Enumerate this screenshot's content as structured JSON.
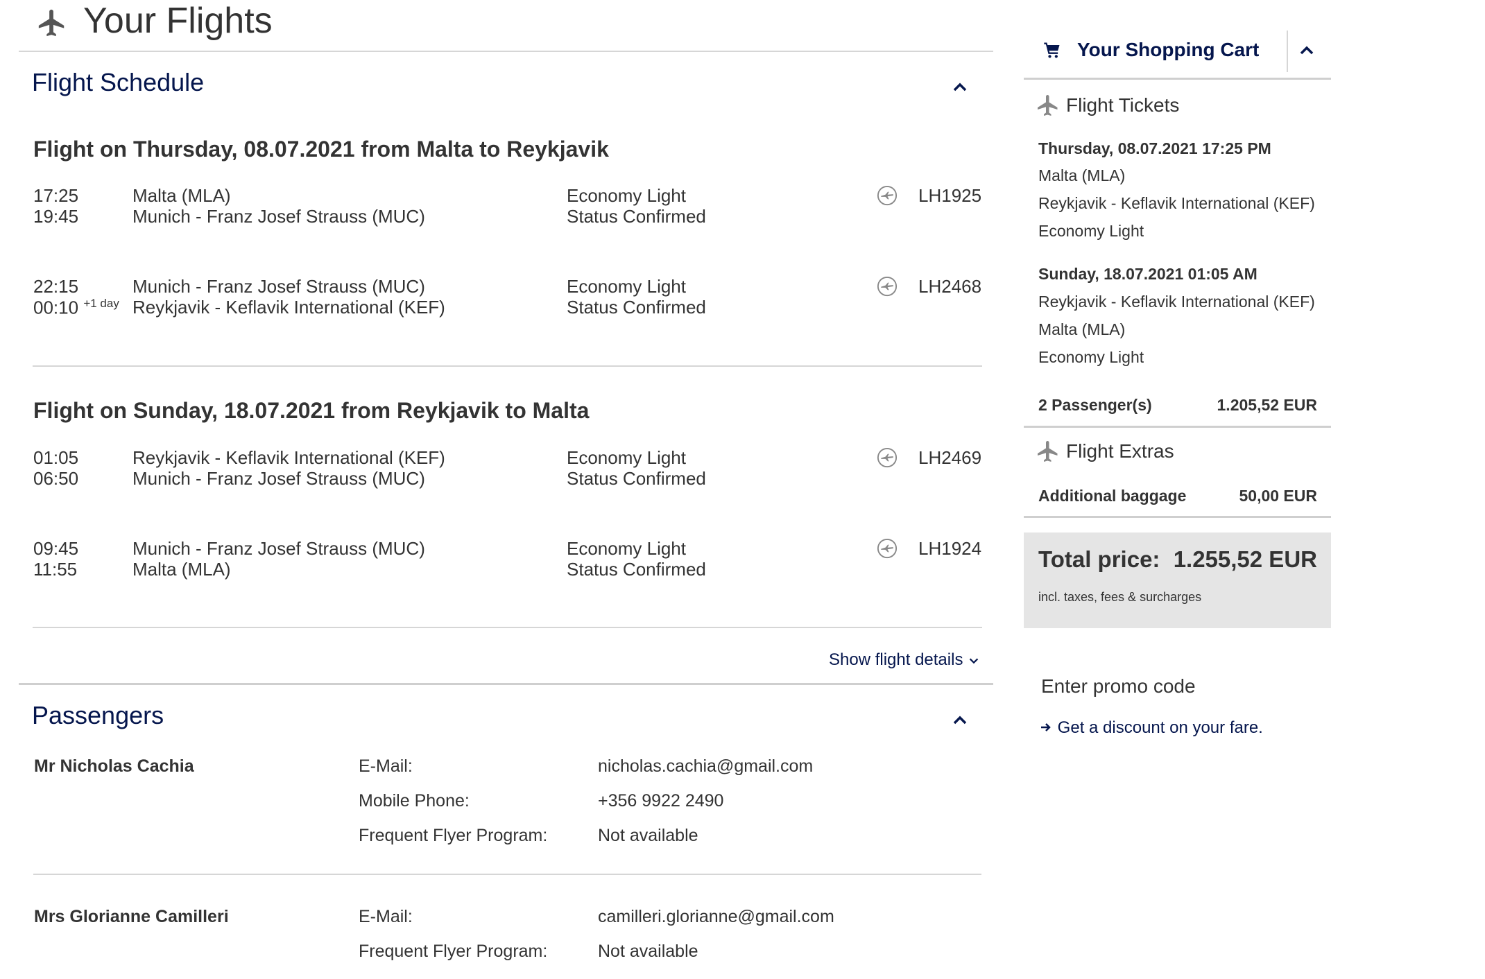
{
  "page": {
    "title": "Your Flights"
  },
  "schedule": {
    "title": "Flight Schedule",
    "show_details": "Show flight details",
    "segments": [
      {
        "title": "Flight on Thursday, 08.07.2021 from Malta to Reykjavik",
        "legs": [
          {
            "dep_time": "17:25",
            "arr_time": "19:45",
            "arr_suffix": "",
            "from": "Malta (MLA)",
            "to": "Munich - Franz Josef Strauss (MUC)",
            "fare": "Economy Light",
            "status": "Status Confirmed",
            "flight_no": "LH1925"
          },
          {
            "dep_time": "22:15",
            "arr_time": "00:10",
            "arr_suffix": "+1 day",
            "from": "Munich - Franz Josef Strauss (MUC)",
            "to": "Reykjavik - Keflavik International (KEF)",
            "fare": "Economy Light",
            "status": "Status Confirmed",
            "flight_no": "LH2468"
          }
        ]
      },
      {
        "title": "Flight on Sunday, 18.07.2021 from Reykjavik to Malta",
        "legs": [
          {
            "dep_time": "01:05",
            "arr_time": "06:50",
            "arr_suffix": "",
            "from": "Reykjavik - Keflavik International (KEF)",
            "to": "Munich - Franz Josef Strauss (MUC)",
            "fare": "Economy Light",
            "status": "Status Confirmed",
            "flight_no": "LH2469"
          },
          {
            "dep_time": "09:45",
            "arr_time": "11:55",
            "arr_suffix": "",
            "from": "Munich - Franz Josef Strauss (MUC)",
            "to": "Malta (MLA)",
            "fare": "Economy Light",
            "status": "Status Confirmed",
            "flight_no": "LH1924"
          }
        ]
      }
    ]
  },
  "passengers": {
    "title": "Passengers",
    "list": [
      {
        "name": "Mr Nicholas Cachia",
        "fields": [
          {
            "label": "E-Mail:",
            "value": "nicholas.cachia@gmail.com"
          },
          {
            "label": "Mobile Phone:",
            "value": "+356 9922 2490"
          },
          {
            "label": "Frequent Flyer Program:",
            "value": "Not available"
          }
        ]
      },
      {
        "name": "Mrs Glorianne Camilleri",
        "fields": [
          {
            "label": "E-Mail:",
            "value": "camilleri.glorianne@gmail.com"
          },
          {
            "label": "Frequent Flyer Program:",
            "value": "Not available"
          }
        ]
      }
    ]
  },
  "cart": {
    "title": "Your Shopping Cart",
    "tickets": {
      "title": "Flight Tickets",
      "outbound": {
        "datetime": "Thursday, 08.07.2021 17:25 PM",
        "from": "Malta (MLA)",
        "to": "Reykjavik - Keflavik International (KEF)",
        "fare": "Economy Light"
      },
      "inbound": {
        "datetime": "Sunday, 18.07.2021 01:05 AM",
        "from": "Reykjavik - Keflavik International (KEF)",
        "to": "Malta (MLA)",
        "fare": "Economy Light"
      },
      "passengers_label": "2 Passenger(s)",
      "passengers_price": "1.205,52 EUR"
    },
    "extras": {
      "title": "Flight Extras",
      "item_label": "Additional baggage",
      "item_price": "50,00 EUR"
    },
    "total": {
      "label": "Total price:",
      "value": "1.255,52 EUR",
      "note": "incl. taxes, fees & surcharges"
    },
    "promo": {
      "title": "Enter promo code",
      "link": "Get a discount on your fare."
    }
  },
  "icons": {
    "plane": "plane-icon",
    "chevron_up": "chevron-up-icon",
    "chevron_down": "chevron-down-icon",
    "cart": "shopping-cart-icon",
    "airline": "airline-logo-icon",
    "arrow": "arrow-right-icon"
  },
  "colors": {
    "navy": "#05164d",
    "text": "#333333",
    "panel": "#e5e5e5",
    "divider": "#d6d6d6",
    "icon_grey": "#888888"
  }
}
